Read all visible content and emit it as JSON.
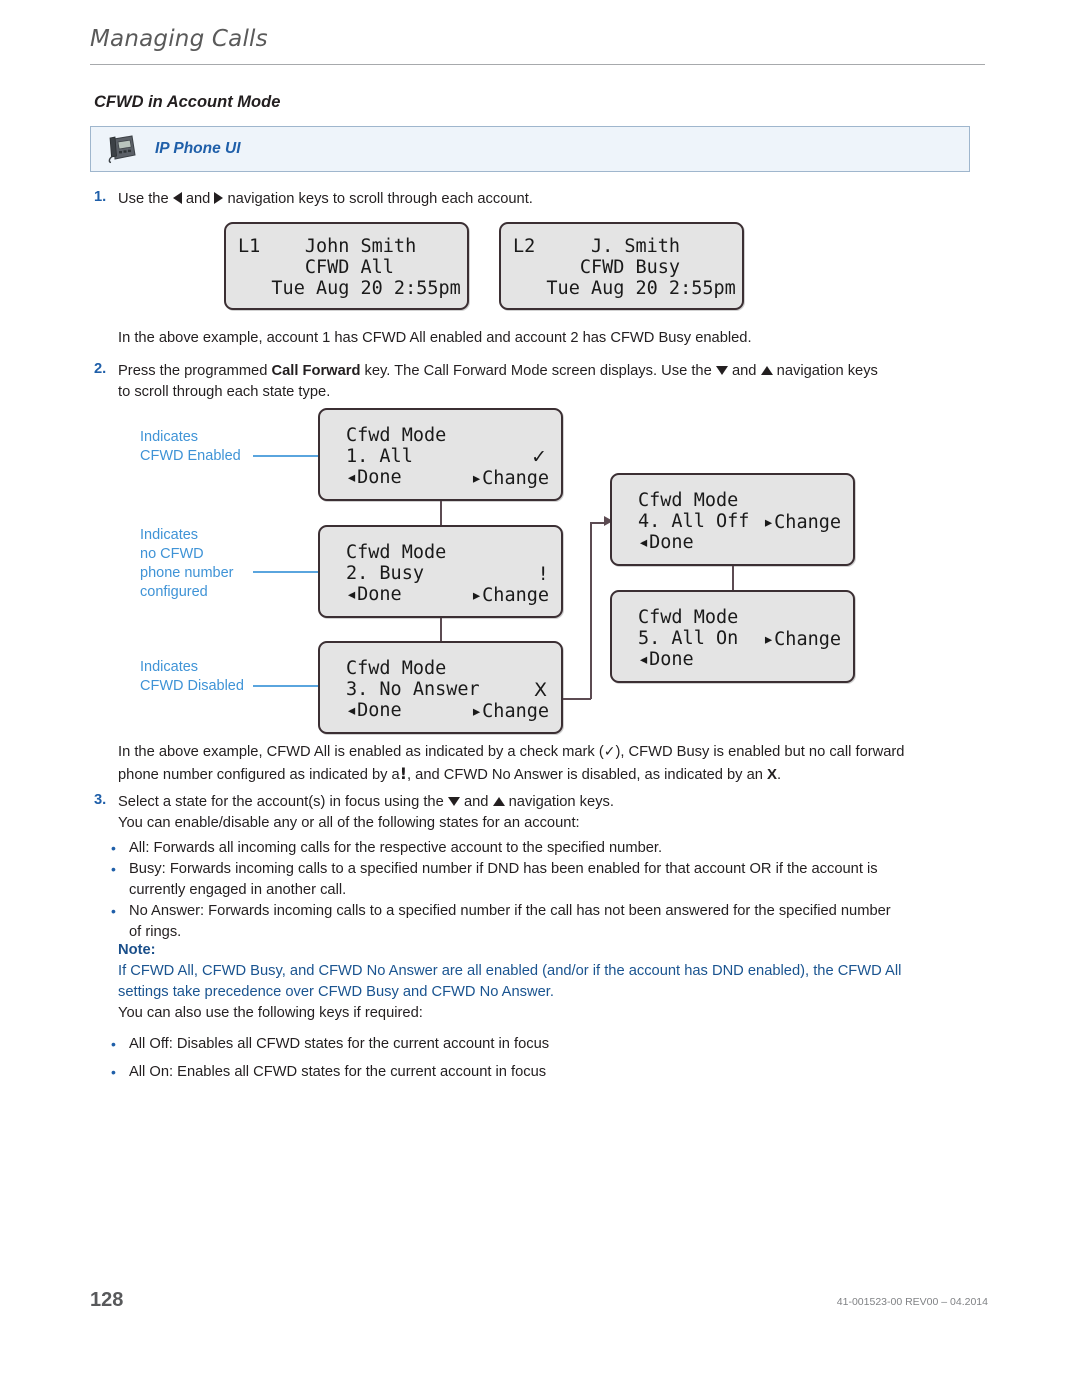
{
  "header": {
    "title": "Managing Calls"
  },
  "section": {
    "heading": "CFWD in Account Mode"
  },
  "banner": {
    "label": "IP Phone UI",
    "icon": "desk-phone-icon"
  },
  "steps": {
    "step1_num": "1.",
    "step1_a": "Use the",
    "step1_b": "and",
    "step1_c": "navigation keys to scroll through each account.",
    "after_accounts": "In the above example, account 1 has CFWD All enabled and account 2 has CFWD Busy enabled.",
    "step2_num": "2.",
    "step2_a": "Press the programmed",
    "step2_bold": "Call Forward",
    "step2_b": "key. The Call Forward Mode screen displays. Use the",
    "step2_c": "and",
    "step2_d": "navigation keys",
    "step2_line2": "to scroll through each state type.",
    "after_diagram_1": "In the above example, CFWD All is enabled as indicated by a check mark (",
    "after_diagram_2": "), CFWD Busy is enabled but no call",
    "after_diagram_3": "forward phone number configured as indicated by a",
    "after_diagram_4": ", and CFWD No Answer is disabled, as indicated by an",
    "after_diagram_5": ".",
    "step3_num": "3.",
    "step3_a": "Select a state for the account(s) in focus using the",
    "step3_b": "and",
    "step3_c": "navigation keys.",
    "step3_line2": "You can enable/disable any or all of the following states for an account:"
  },
  "bullets_states": [
    "All: Forwards all incoming calls for the respective account to the specified number.",
    "Busy: Forwards incoming calls to a specified number if DND has been enabled for that account OR if the account is currently engaged in another call.",
    "No Answer: Forwards incoming calls to a specified number if the call has not been answered for the specified number of rings."
  ],
  "note": {
    "label": "Note:",
    "body_line1": "If CFWD All, CFWD Busy, and CFWD No Answer are all enabled (and/or if the account has DND enabled), the CFWD",
    "body_line2": "All settings take precedence over CFWD Busy and CFWD No Answer.",
    "follow": "You can also use the following keys if required:"
  },
  "bullets_keys": [
    "All Off: Disables all CFWD states for the current account in focus",
    "All On: Enables all CFWD states for the current account in focus"
  ],
  "account_screens": [
    {
      "line1": "L1    John Smith",
      "line2": "      CFWD All",
      "line3": "   Tue Aug 20 2:55pm"
    },
    {
      "line1": "L2     J. Smith",
      "line2": "      CFWD Busy",
      "line3": "   Tue Aug 20 2:55pm"
    }
  ],
  "cfwd_screens": [
    {
      "title": "Cfwd Mode",
      "item": "1. All",
      "softkey_left": "◂Done",
      "softkey_right": "▸Change",
      "status": "✓",
      "status_name": "check-mark"
    },
    {
      "title": "Cfwd Mode",
      "item": "2. Busy",
      "softkey_left": "◂Done",
      "softkey_right": "▸Change",
      "status": "!",
      "status_name": "exclamation-mark"
    },
    {
      "title": "Cfwd Mode",
      "item": "3. No Answer",
      "softkey_left": "◂Done",
      "softkey_right": "▸Change",
      "status": "X",
      "status_name": "x-mark"
    },
    {
      "title": "Cfwd Mode",
      "item": "4. All Off",
      "softkey_left": "◂Done",
      "softkey_right": "▸Change",
      "status": "",
      "status_name": "none"
    },
    {
      "title": "Cfwd Mode",
      "item": "5. All On",
      "softkey_left": "◂Done",
      "softkey_right": "▸Change",
      "status": "",
      "status_name": "none"
    }
  ],
  "annotations": [
    {
      "line1": "Indicates",
      "line2": "CFWD Enabled",
      "line3": "",
      "line4": ""
    },
    {
      "line1": "Indicates",
      "line2": "no CFWD",
      "line3": "phone number",
      "line4": "configured"
    },
    {
      "line1": "Indicates",
      "line2": "CFWD Disabled",
      "line3": "",
      "line4": ""
    }
  ],
  "footer": {
    "page_number": "128",
    "reference": "41-001523-00 REV00 – 04.2014"
  },
  "colors": {
    "accent_blue": "#1f5fa9",
    "annotation_blue": "#3f93d6",
    "note_blue": "#1a5490",
    "lcd_bg": "#e4e4e4",
    "banner_bg": "#eef4fa"
  }
}
